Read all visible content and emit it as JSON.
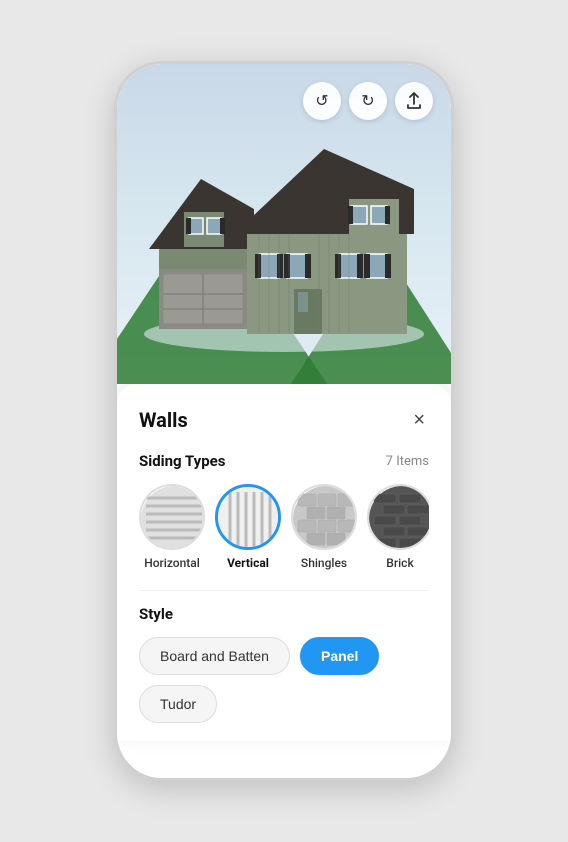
{
  "toolbar": {
    "undo_label": "↺",
    "redo_label": "↻",
    "share_label": "⬆"
  },
  "panel": {
    "title": "Walls",
    "close_label": "×",
    "siding_section": {
      "label": "Siding Types",
      "count": "7 Items",
      "items": [
        {
          "id": "horizontal",
          "label": "Horizontal",
          "selected": false
        },
        {
          "id": "vertical",
          "label": "Vertical",
          "selected": true
        },
        {
          "id": "shingles",
          "label": "Shingles",
          "selected": false
        },
        {
          "id": "brick",
          "label": "Brick",
          "selected": false
        }
      ]
    },
    "style_section": {
      "label": "Style",
      "items": [
        {
          "id": "board-and-batten",
          "label": "Board and Batten",
          "active": false
        },
        {
          "id": "panel",
          "label": "Panel",
          "active": true
        },
        {
          "id": "tudor",
          "label": "Tudor",
          "active": false
        }
      ]
    }
  }
}
